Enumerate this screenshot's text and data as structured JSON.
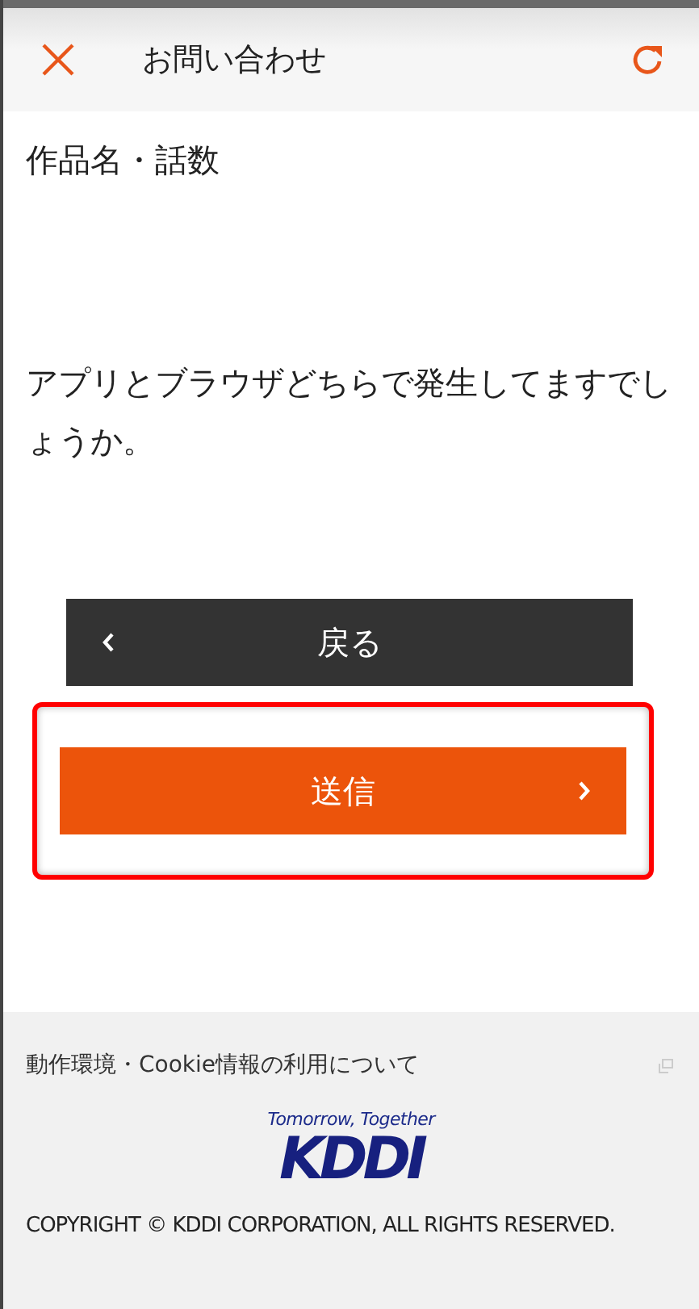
{
  "header": {
    "title": "お問い合わせ"
  },
  "fields": [
    {
      "label": "作品名・話数"
    },
    {
      "label": "アプリとブラウザどちらで発生してますでしょうか。"
    }
  ],
  "buttons": [
    {
      "kind": "back",
      "label": "戻る",
      "highlighted": false
    },
    {
      "kind": "submit",
      "label": "送信",
      "highlighted": true
    }
  ],
  "footer": {
    "link": "動作環境・Cookie情報の利用について",
    "tagline": "Tomorrow, Together",
    "logo": "KDDI",
    "copyright": "COPYRIGHT © KDDI CORPORATION, ALL RIGHTS RESERVED."
  }
}
